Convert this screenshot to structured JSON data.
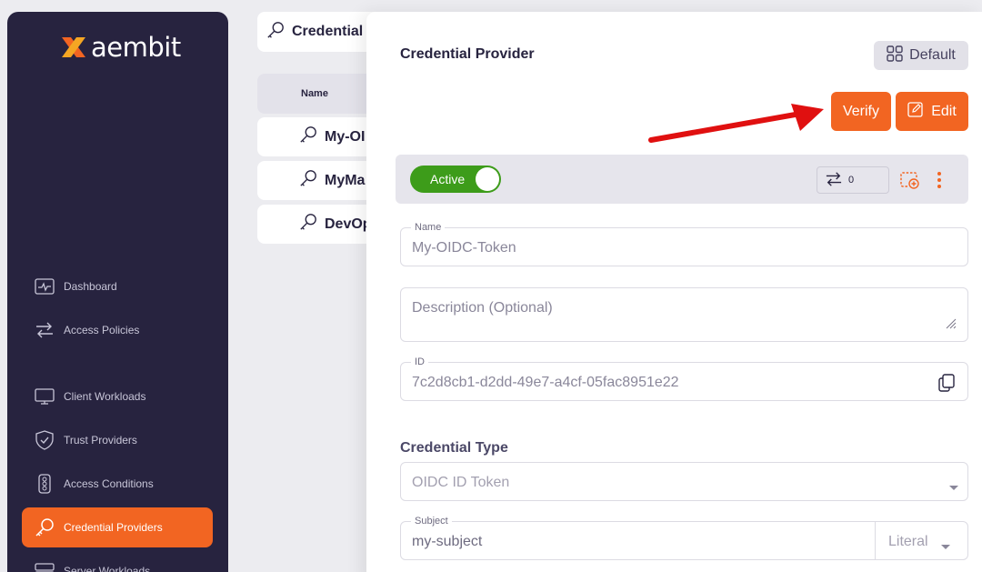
{
  "brand": {
    "name": "aembit"
  },
  "sidebar": {
    "items": [
      {
        "label": "Dashboard",
        "icon": "dashboard-icon"
      },
      {
        "label": "Access Policies",
        "icon": "arrows-icon"
      },
      {
        "label": "Client Workloads",
        "icon": "monitor-icon"
      },
      {
        "label": "Trust Providers",
        "icon": "shield-icon"
      },
      {
        "label": "Access Conditions",
        "icon": "traffic-light-icon"
      },
      {
        "label": "Credential Providers",
        "icon": "key-icon",
        "active": true
      },
      {
        "label": "Server Workloads",
        "icon": "server-icon"
      }
    ]
  },
  "list": {
    "header": "Credential",
    "column_name": "Name",
    "rows": [
      "My-OI",
      "MyMa",
      "DevOp"
    ]
  },
  "drawer": {
    "title": "Credential Provider",
    "default_label": "Default",
    "verify_label": "Verify",
    "edit_label": "Edit",
    "status_label": "Active",
    "count": "0",
    "name_label": "Name",
    "name_value": "My-OIDC-Token",
    "description_placeholder": "Description (Optional)",
    "id_label": "ID",
    "id_value": "7c2d8cb1-d2dd-49e7-a4cf-05fac8951e22",
    "credential_type_title": "Credential Type",
    "credential_type_value": "OIDC ID Token",
    "subject_label": "Subject",
    "subject_value": "my-subject",
    "subject_type": "Literal"
  },
  "colors": {
    "accent": "#f26522",
    "sidebar": "#27233f",
    "active": "#3d9c1a",
    "arrow": "#e01010"
  }
}
